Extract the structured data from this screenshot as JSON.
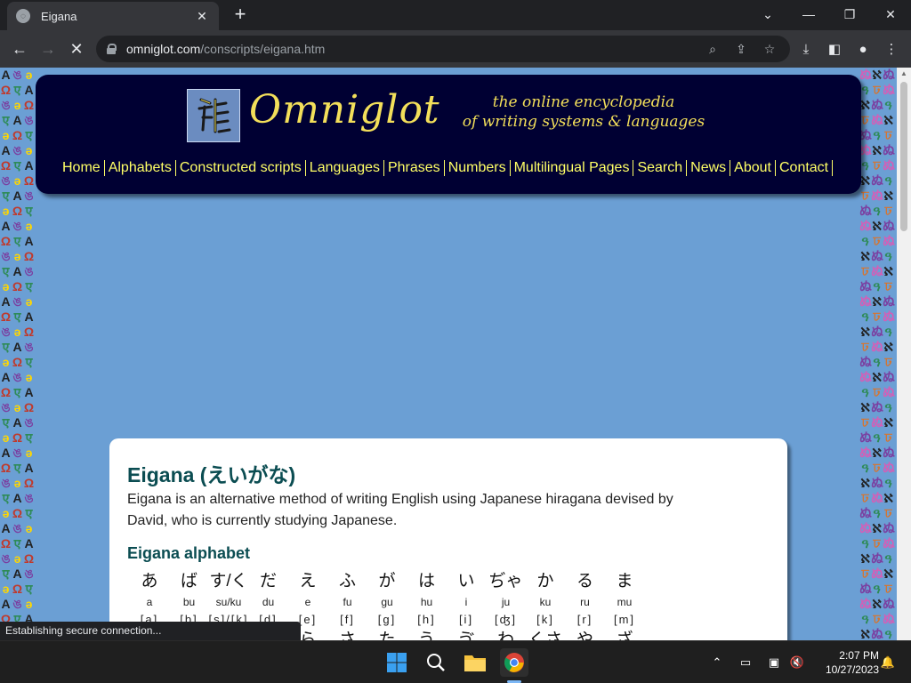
{
  "browser": {
    "tab_title": "Eigana",
    "tab_close": "✕",
    "new_tab": "+",
    "url_host": "omniglot.com",
    "url_path": "/conscripts/eigana.htm"
  },
  "site": {
    "name": "Omniglot",
    "tagline_line1": "the online encyclopedia",
    "tagline_line2": "of writing systems & languages",
    "nav": [
      "Home",
      "Alphabets",
      "Constructed scripts",
      "Languages",
      "Phrases",
      "Numbers",
      "Multilingual Pages",
      "Search",
      "News",
      "About",
      "Contact"
    ]
  },
  "article": {
    "title": "Eigana (えいがな)",
    "intro_line1": "Eigana is an alternative method of writing English using Japanese hiragana devised by",
    "intro_line2": "David, who is currently studying Japanese.",
    "subheading": "Eigana alphabet",
    "alphabet": [
      {
        "kana": "あ",
        "roman": "a",
        "ipa": "[a]",
        "next": ""
      },
      {
        "kana": "ば",
        "roman": "bu",
        "ipa": "[b]",
        "next": ""
      },
      {
        "kana": "す/く",
        "roman": "su/ku",
        "ipa": "[s]/[k]",
        "next": ""
      },
      {
        "kana": "だ",
        "roman": "du",
        "ipa": "[d]",
        "next": "わ"
      },
      {
        "kana": "え",
        "roman": "e",
        "ipa": "[e]",
        "next": "ら"
      },
      {
        "kana": "ふ",
        "roman": "fu",
        "ipa": "[f]",
        "next": "さ"
      },
      {
        "kana": "が",
        "roman": "gu",
        "ipa": "[g]",
        "next": "た"
      },
      {
        "kana": "は",
        "roman": "hu",
        "ipa": "[h]",
        "next": "う"
      },
      {
        "kana": "い",
        "roman": "i",
        "ipa": "[i]",
        "next": "ゔ"
      },
      {
        "kana": "ぢゃ",
        "roman": "ju",
        "ipa": "[ʤ]",
        "next": "わ"
      },
      {
        "kana": "か",
        "roman": "ku",
        "ipa": "[k]",
        "next": "くさ"
      },
      {
        "kana": "る",
        "roman": "ru",
        "ipa": "[r]",
        "next": "や"
      },
      {
        "kana": "ま",
        "roman": "mu",
        "ipa": "[m]",
        "next": "ざ"
      }
    ]
  },
  "status": "Establishing secure connection...",
  "clock": {
    "time": "2:07 PM",
    "date": "10/27/2023"
  }
}
